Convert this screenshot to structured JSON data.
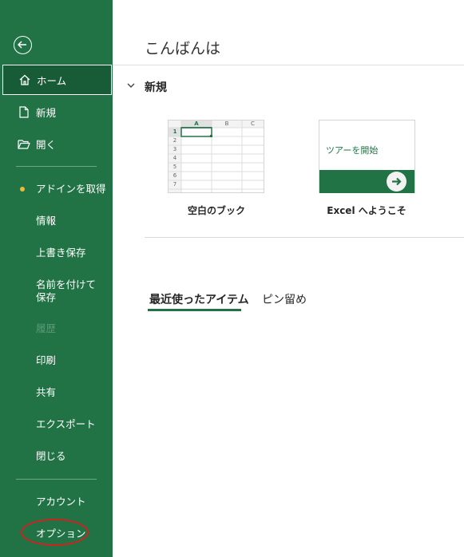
{
  "sidebar": {
    "items": [
      {
        "label": "ホーム"
      },
      {
        "label": "新規"
      },
      {
        "label": "開く"
      },
      {
        "label": "アドインを取得"
      },
      {
        "label": "情報"
      },
      {
        "label": "上書き保存"
      },
      {
        "label": "名前を付けて保存"
      },
      {
        "label": "履歴"
      },
      {
        "label": "印刷"
      },
      {
        "label": "共有"
      },
      {
        "label": "エクスポート"
      },
      {
        "label": "閉じる"
      },
      {
        "label": "アカウント"
      },
      {
        "label": "オプション"
      }
    ]
  },
  "main": {
    "greeting": "こんばんは",
    "new_section": "新規",
    "templates": [
      {
        "caption": "空白のブック"
      },
      {
        "caption": "Excel へようこそ",
        "tile_text": "ツアーを開始"
      }
    ],
    "grid": {
      "columns": [
        "A",
        "B",
        "C"
      ],
      "rows": [
        "1",
        "2",
        "3",
        "4",
        "5",
        "6",
        "7"
      ]
    },
    "tabs": [
      {
        "label": "最近使ったアイテム",
        "selected": true
      },
      {
        "label": "ピン留め",
        "selected": false
      }
    ]
  },
  "colors": {
    "accent": "#217346",
    "sidebar_active": "#185c37",
    "highlight_circle": "#d42020"
  }
}
